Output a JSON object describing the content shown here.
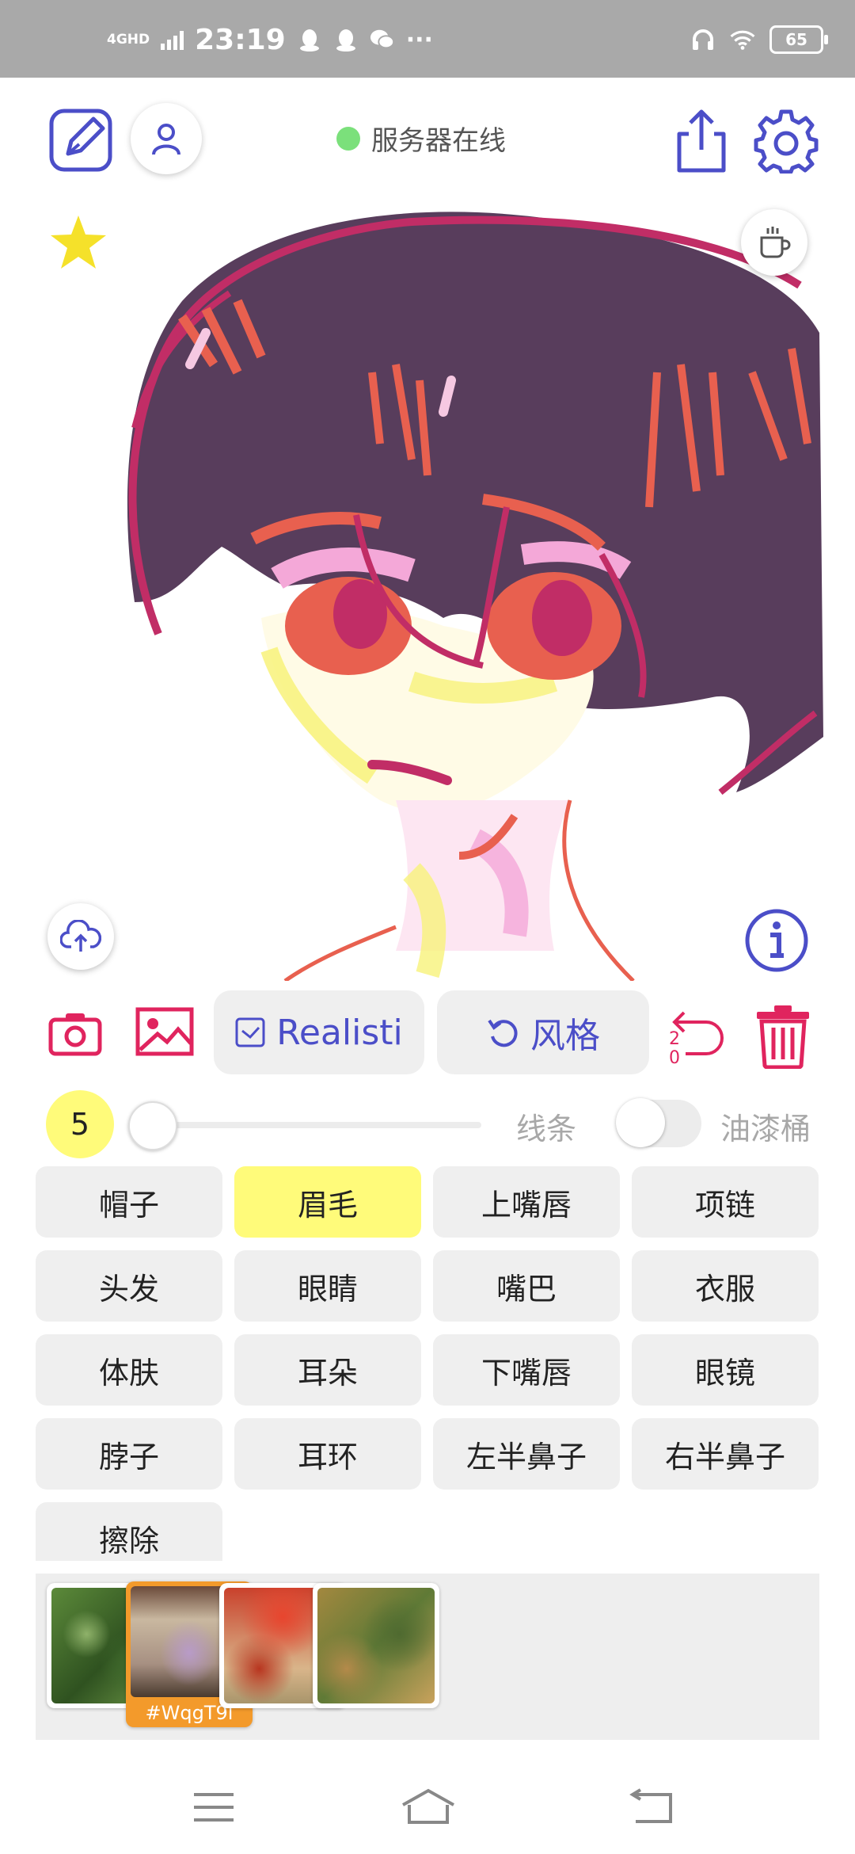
{
  "status_bar": {
    "network": "4GHD",
    "time": "23:19",
    "more": "···",
    "battery": "65"
  },
  "header": {
    "server_status": "服务器在线",
    "server_status_color": "#7be07b",
    "accent_color": "#4b4ec8"
  },
  "canvas": {
    "icons": [
      "star-icon",
      "cup-icon",
      "cloud-upload-icon",
      "info-icon"
    ]
  },
  "tools": {
    "style_model": "Realisti",
    "style_button": "风格",
    "undo_count": "20",
    "danger_color": "#e0245e"
  },
  "brush": {
    "size": "5",
    "mode_line": "线条",
    "mode_bucket": "油漆桶",
    "slider_value": 0
  },
  "labels": {
    "selected": "眉毛",
    "items": [
      "帽子",
      "眉毛",
      "上嘴唇",
      "项链",
      "头发",
      "眼睛",
      "嘴巴",
      "衣服",
      "体肤",
      "耳朵",
      "下嘴唇",
      "眼镜",
      "脖子",
      "耳环",
      "左半鼻子",
      "右半鼻子",
      "擦除"
    ]
  },
  "thumbnails": {
    "selected_tag": "#WqgT9l",
    "selected_index": 1,
    "count": 4
  }
}
